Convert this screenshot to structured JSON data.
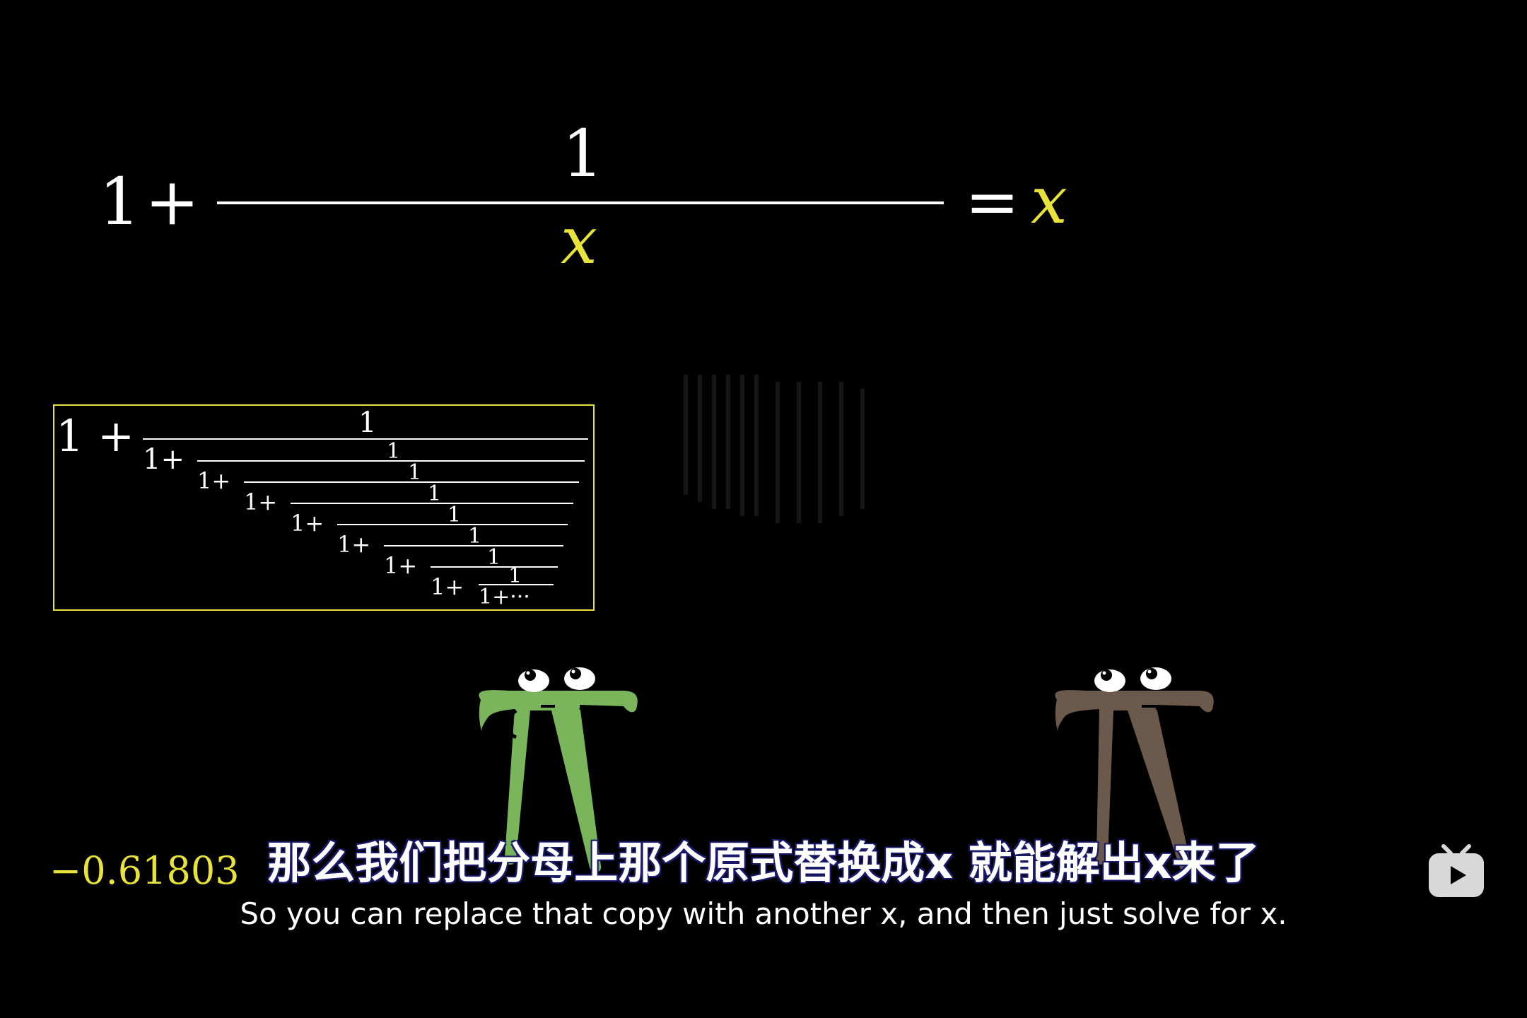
{
  "main_equation": {
    "lhs_one": "1",
    "lhs_plus": "+",
    "numerator": "1",
    "denominator": "x",
    "equals": "=",
    "rhs": "x"
  },
  "continued_fraction": {
    "lead": "1 +",
    "one": "1",
    "one_plus": "1+",
    "tail": "1+···"
  },
  "side_value": "−0.61803",
  "subtitle_zh": "那么我们把分母上那个原式替换成x  就能解出x来了",
  "subtitle_en": "So you can replace that copy with another x, and then just solve for x.",
  "colors": {
    "accent_yellow": "#e8e23c",
    "green_pi": "#7ab55c",
    "brown_pi": "#6b5a4c"
  },
  "icons": [
    "play-logo-icon"
  ]
}
